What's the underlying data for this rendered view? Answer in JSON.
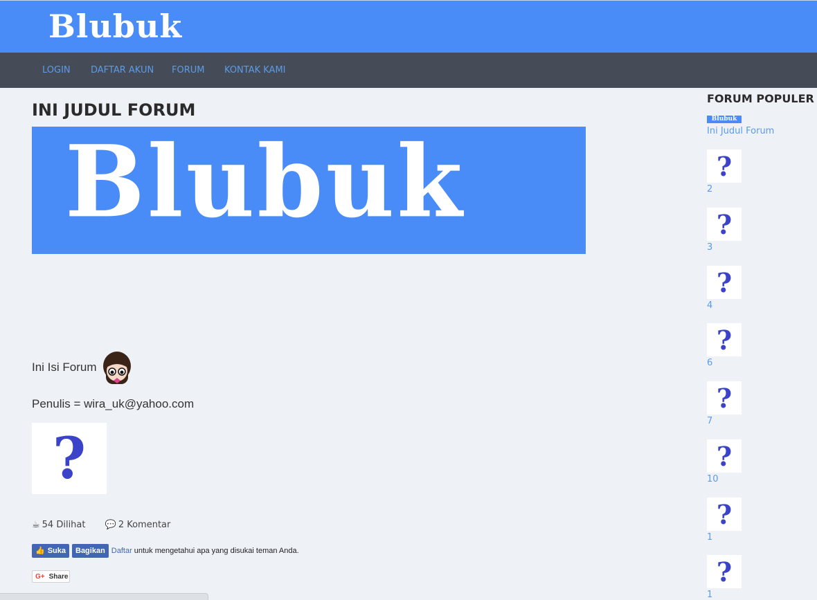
{
  "header": {
    "logo_text": "Blubuk"
  },
  "nav": {
    "items": [
      "LOGIN",
      "DAFTAR AKUN",
      "FORUM",
      "KONTAK KAMI"
    ]
  },
  "post": {
    "title": "INI JUDUL FORUM",
    "banner_text": "Blubuk",
    "body_text": "Ini Isi Forum",
    "author_line": "Penulis = wira_uk@yahoo.com",
    "views": "54 Dilihat",
    "comments": "2 Komentar"
  },
  "facebook": {
    "like_label": "Suka",
    "share_label": "Bagikan",
    "signup_link": "Daftar",
    "signup_text": "untuk mengetahui apa yang disukai teman Anda."
  },
  "gplus": {
    "label": "Share"
  },
  "sidebar": {
    "title": "FORUM POPULER",
    "first": {
      "logo_text": "Blubuk",
      "label": "Ini Judul Forum"
    },
    "items": [
      "2",
      "3",
      "4",
      "6",
      "7",
      "10",
      "1",
      "1"
    ]
  },
  "colors": {
    "header_bg": "#4a8cf7",
    "nav_bg": "#464c57",
    "link": "#5b9be8",
    "question_mark": "#3b43c8"
  }
}
